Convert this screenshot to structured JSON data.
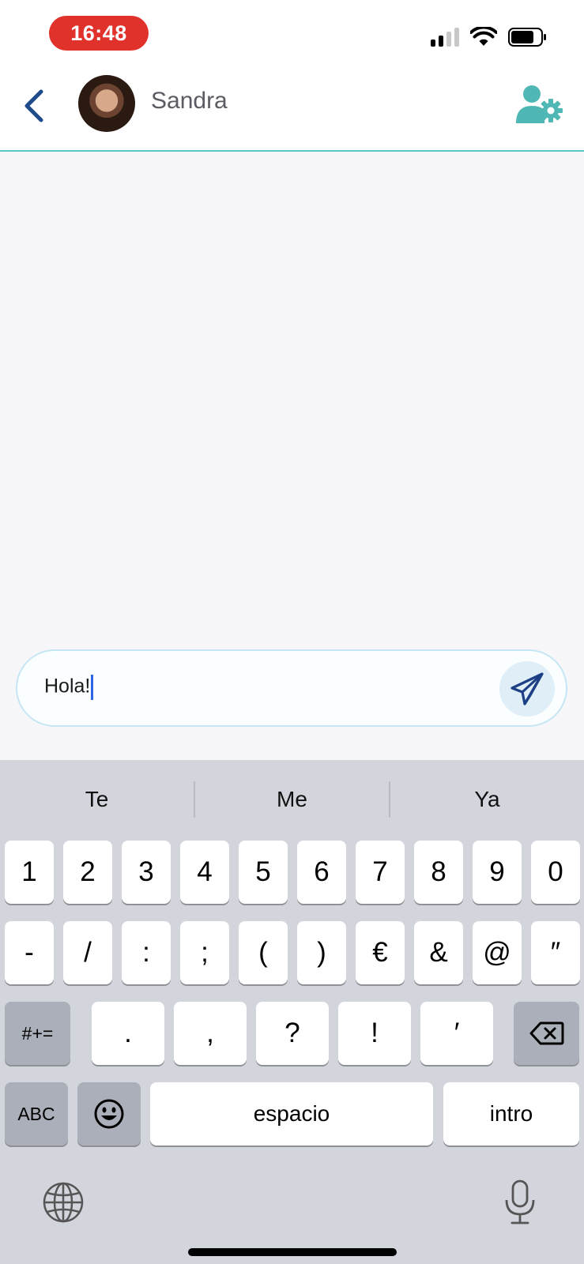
{
  "status_bar": {
    "time": "16:48"
  },
  "header": {
    "contact_name": "Sandra"
  },
  "composer": {
    "text": "Hola!"
  },
  "keyboard": {
    "suggestions": [
      "Te",
      "Me",
      "Ya"
    ],
    "row1": [
      "1",
      "2",
      "3",
      "4",
      "5",
      "6",
      "7",
      "8",
      "9",
      "0"
    ],
    "row2": [
      "-",
      "/",
      ":",
      ";",
      "(",
      ")",
      "€",
      "&",
      "@",
      "″"
    ],
    "row3_left": "#+=",
    "row3": [
      ".",
      ",",
      "?",
      "!",
      "′"
    ],
    "abc": "ABC",
    "space": "espacio",
    "return": "intro"
  },
  "colors": {
    "accent_teal": "#56c7c2",
    "back_blue": "#1f4a8c",
    "time_pill": "#e0312a",
    "caret": "#2f64e8"
  },
  "icons": [
    "back-chevron-icon",
    "user-settings-icon",
    "send-icon",
    "backspace-icon",
    "emoji-icon",
    "globe-icon",
    "microphone-icon"
  ]
}
